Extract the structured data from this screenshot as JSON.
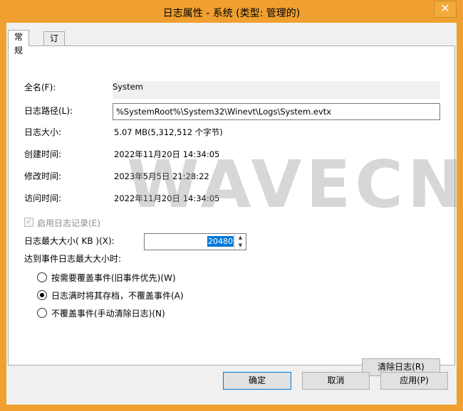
{
  "window": {
    "title": "日志属性 - 系统 (类型: 管理的)",
    "close_glyph": "✕"
  },
  "tabs": [
    {
      "label": "常规"
    },
    {
      "label": "订阅"
    }
  ],
  "general": {
    "full_name_label": "全名(F):",
    "full_name_value": "System",
    "log_path_label": "日志路径(L):",
    "log_path_value": "%SystemRoot%\\System32\\Winevt\\Logs\\System.evtx",
    "log_size_label": "日志大小:",
    "log_size_value": "5.07 MB(5,312,512 个字节)",
    "created_label": "创建时间:",
    "created_value": "2022年11月20日 14:34:05",
    "modified_label": "修改时间:",
    "modified_value": "2023年5月5日 21:28:22",
    "accessed_label": "访问时间:",
    "accessed_value": "2022年11月20日 14:34:05",
    "enable_logging_label": "启用日志记录(E)",
    "max_size_label": "日志最大大小( KB )(X):",
    "max_size_value": "20480",
    "when_max_label": "达到事件日志最大大小时:",
    "options": [
      {
        "label": "按需要覆盖事件(旧事件优先)(W)",
        "selected": false
      },
      {
        "label": "日志满时将其存档，不覆盖事件(A)",
        "selected": true
      },
      {
        "label": "不覆盖事件(手动清除日志)(N)",
        "selected": false
      }
    ],
    "clear_log_button": "清除日志(R)"
  },
  "footer": {
    "ok": "确定",
    "cancel": "取消",
    "apply": "应用(P)"
  },
  "watermark": "WAVECN",
  "colors": {
    "titlebar": "#f0a030",
    "accent": "#0078d7"
  }
}
